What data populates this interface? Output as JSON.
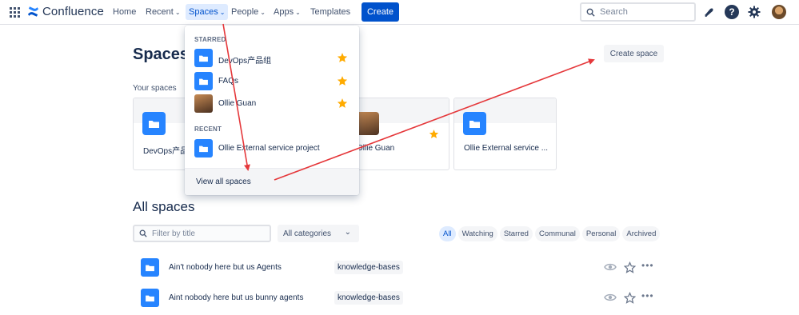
{
  "nav": {
    "product_name": "Confluence",
    "items": [
      "Home",
      "Recent",
      "Spaces",
      "People",
      "Apps",
      "Templates"
    ],
    "create_label": "Create",
    "search_placeholder": "Search",
    "help_glyph": "?"
  },
  "page": {
    "title": "Spaces",
    "create_space_label": "Create space",
    "your_spaces_label": "Your spaces",
    "cards": [
      {
        "name": "DevOps产品组",
        "icon": "folder-icon",
        "starred": false
      },
      {
        "name": "Ollie Guan",
        "icon": "avatar",
        "starred": true
      },
      {
        "name": "Ollie External service ...",
        "icon": "folder-icon",
        "starred": false
      }
    ],
    "all_spaces_title": "All spaces",
    "filter_placeholder": "Filter by title",
    "category_select": "All categories",
    "pills": [
      "All",
      "Watching",
      "Starred",
      "Communal",
      "Personal",
      "Archived"
    ],
    "active_pill": "All",
    "rows": [
      {
        "name": "Ain't nobody here but us Agents",
        "category": "knowledge-bases"
      },
      {
        "name": "Aint nobody here but us bunny agents",
        "category": "knowledge-bases"
      }
    ]
  },
  "dropdown": {
    "starred_heading": "STARRED",
    "starred": [
      {
        "name": "DevOps产品组",
        "icon": "folder-icon"
      },
      {
        "name": "FAQs",
        "icon": "folder-icon"
      },
      {
        "name": "Ollie Guan",
        "icon": "avatar"
      }
    ],
    "recent_heading": "RECENT",
    "recent": [
      {
        "name": "Ollie External service project",
        "icon": "folder-icon"
      }
    ],
    "footer_label": "View all spaces"
  },
  "colors": {
    "brand": "#0052cc",
    "space_icon": "#2684ff",
    "star": "#ffab00",
    "annotation_arrow": "#e5383b"
  }
}
